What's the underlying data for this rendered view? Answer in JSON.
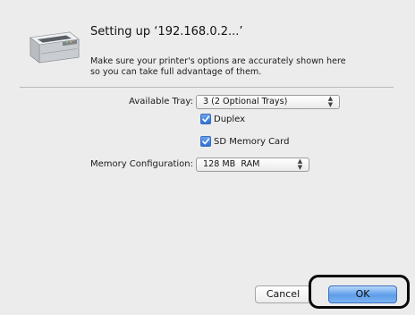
{
  "dialog": {
    "title": "Setting up ‘192.168.0.2...’",
    "description_line1": "Make sure your printer's options are accurately shown here",
    "description_line2": "so you can take full advantage of them."
  },
  "options": {
    "available_tray": {
      "label": "Available Tray:",
      "value": "3 (2 Optional Trays)"
    },
    "duplex": {
      "label": "Duplex",
      "checked": true
    },
    "sd_memory_card": {
      "label": "SD Memory Card",
      "checked": true
    },
    "memory_configuration": {
      "label": "Memory Configuration:",
      "value": "128 MB  RAM"
    }
  },
  "buttons": {
    "cancel": "Cancel",
    "ok": "OK"
  },
  "icons": {
    "printer": "printer-icon",
    "popup_arrows": "updown-arrows-icon",
    "checkmark": "checkmark-icon"
  },
  "colors": {
    "dialog_background": "#ececec",
    "default_button": "#5e9de9",
    "checkbox": "#2d6fd8",
    "callout_outline": "#0a0a0a"
  }
}
